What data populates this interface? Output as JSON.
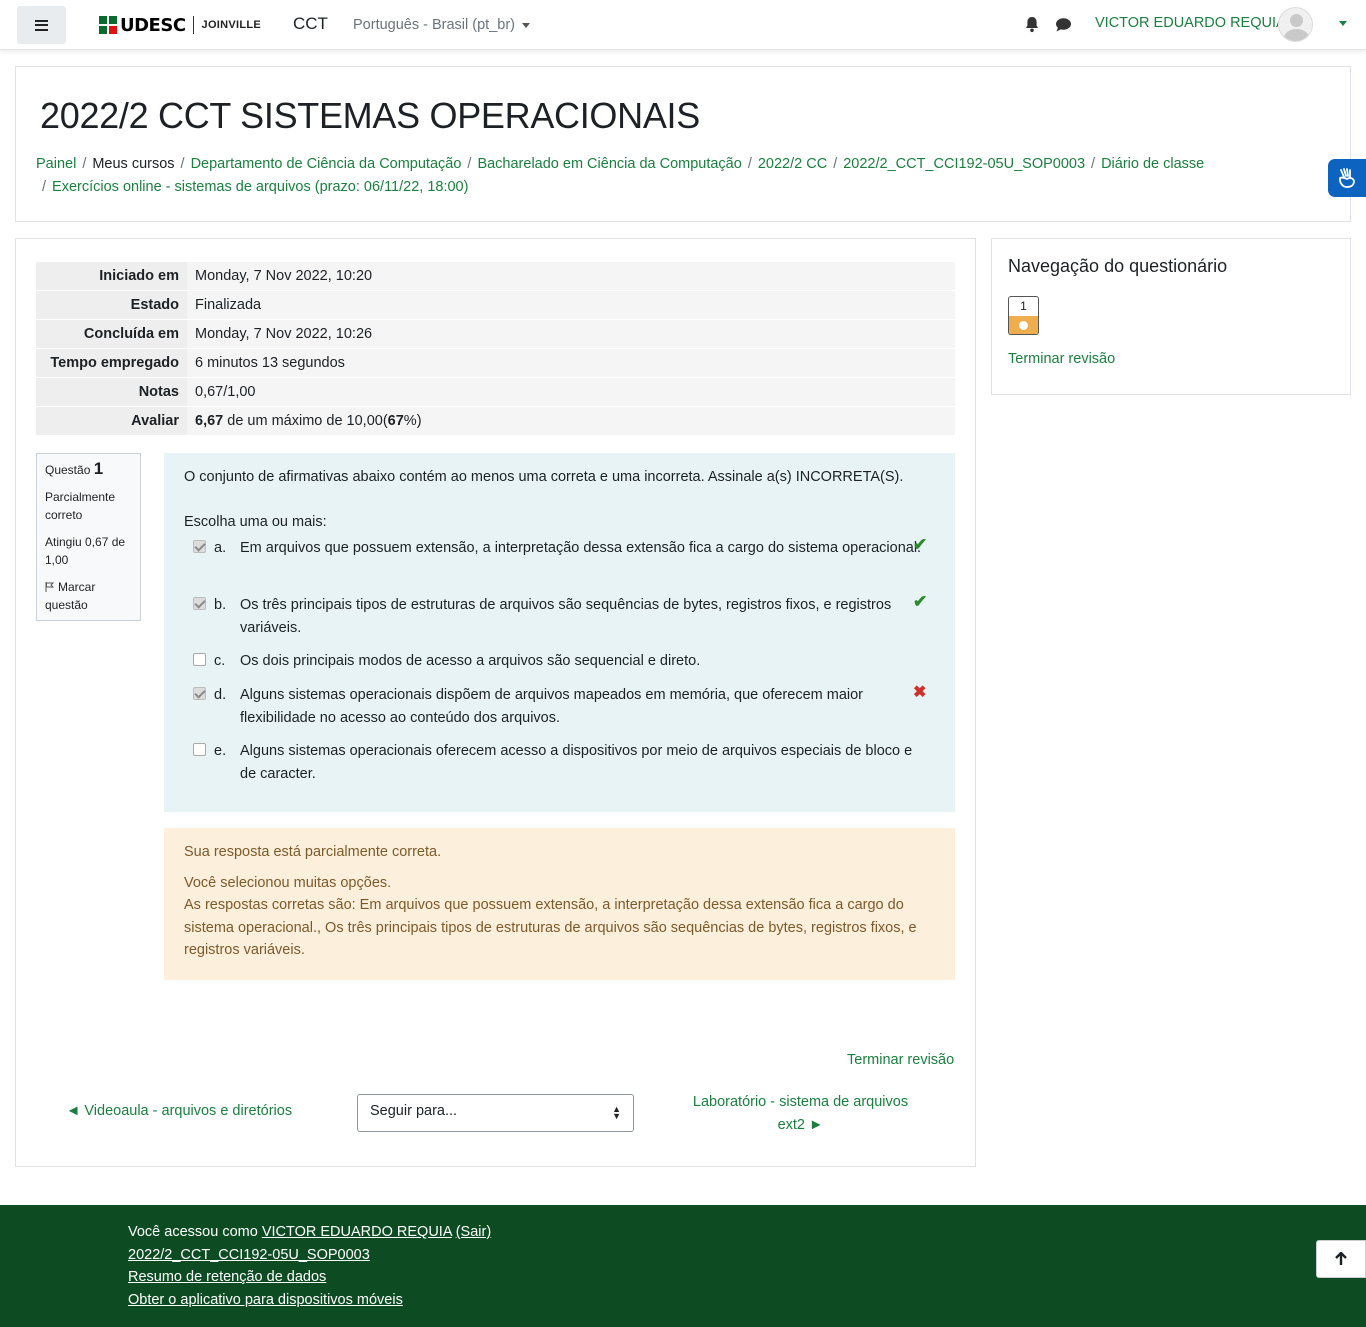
{
  "navbar": {
    "logo_text": "UDESC",
    "logo_sub": "JOINVILLE",
    "site_name": "CCT",
    "language": "Português - Brasil (pt_br)",
    "user_name": "VICTOR EDUARDO REQUIA",
    "icons": [
      "menu-icon",
      "bell-icon",
      "chat-icon",
      "avatar"
    ]
  },
  "page": {
    "title": "2022/2 CCT SISTEMAS OPERACIONAIS",
    "breadcrumb": [
      "Painel",
      "Meus cursos",
      "Departamento de Ciência da Computação",
      "Bacharelado em Ciência da Computação",
      "2022/2 CC",
      "2022/2_CCT_CCI192-05U_SOP0003",
      "Diário de classe",
      "Exercícios online - sistemas de arquivos (prazo: 06/11/22, 18:00)"
    ]
  },
  "summary": [
    {
      "label": "Iniciado em",
      "value": "Monday, 7 Nov 2022, 10:20"
    },
    {
      "label": "Estado",
      "value": "Finalizada"
    },
    {
      "label": "Concluída em",
      "value": "Monday, 7 Nov 2022, 10:26"
    },
    {
      "label": "Tempo empregado",
      "value": "6 minutos 13 segundos"
    },
    {
      "label": "Notas",
      "value": "0,67/1,00"
    },
    {
      "label": "Avaliar",
      "grade": "6,67",
      "grade_mid": " de um máximo de 10,00(",
      "percent": "67",
      "grade_end": "%)"
    }
  ],
  "question": {
    "label": "Questão",
    "number": "1",
    "state": "Parcialmente correto",
    "mark": "Atingiu 0,67 de 1,00",
    "flag_label": "Marcar questão",
    "prompt": "O conjunto de afirmativas abaixo contém ao menos uma correta e uma incorreta. Assinale a(s) INCORRETA(S).",
    "choose": "Escolha uma ou mais:",
    "answers": [
      {
        "letter": "a.",
        "text": "Em arquivos que possuem extensão, a interpretação dessa extensão fica a cargo do sistema operacional.",
        "checked": true,
        "result": "correct"
      },
      {
        "letter": "b.",
        "text": "Os três principais tipos de estruturas de arquivos são sequências de bytes, registros fixos, e registros variáveis.",
        "checked": true,
        "result": "correct"
      },
      {
        "letter": "c.",
        "text": "Os dois principais modos de acesso a arquivos são sequencial e direto.",
        "checked": false,
        "result": ""
      },
      {
        "letter": "d.",
        "text": "Alguns sistemas operacionais dispõem de arquivos mapeados em memória, que oferecem maior flexibilidade no acesso ao conteúdo dos arquivos.",
        "checked": true,
        "result": "incorrect"
      },
      {
        "letter": "e.",
        "text": "Alguns sistemas operacionais oferecem acesso a dispositivos por meio de arquivos especiais de bloco e de caracter.",
        "checked": false,
        "result": ""
      }
    ],
    "feedback": {
      "status": "Sua resposta está parcialmente correta.",
      "too_many": "Você selecionou muitas opções.",
      "correct_answers": "As respostas corretas são: Em arquivos que possuem extensão, a interpretação dessa extensão fica a cargo do sistema operacional., Os três principais tipos de estruturas de arquivos são sequências de bytes, registros fixos, e registros variáveis."
    }
  },
  "navigation": {
    "finish_review": "Terminar revisão",
    "prev_activity": "◄ Videoaula - arquivos e diretórios",
    "jump_placeholder": "Seguir para...",
    "next_activity": "Laboratório - sistema de arquivos ext2 ►"
  },
  "quiz_nav": {
    "title": "Navegação do questionário",
    "question_button": "1",
    "finish_review": "Terminar revisão"
  },
  "footer": {
    "logged_prefix": "Você acessou como ",
    "user_name": "VICTOR EDUARDO REQUIA",
    "logout": "(Sair)",
    "course_link": "2022/2_CCT_CCI192-05U_SOP0003",
    "data_retention": "Resumo de retenção de dados",
    "mobile_app": "Obter o aplicativo para dispositivos móveis"
  },
  "colors": {
    "link": "#1a7f3f",
    "footer_bg": "#0d4c22",
    "question_bg": "#e7f3f5",
    "feedback_bg": "#fcefdc",
    "nav_state": "#f0ad4e"
  }
}
